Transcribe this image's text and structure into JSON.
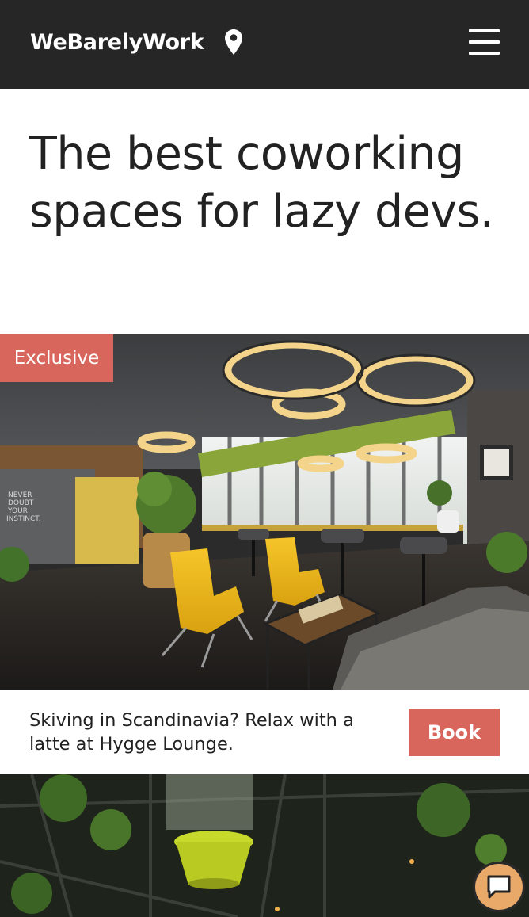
{
  "header": {
    "brand": "WeBarelyWork",
    "location_icon": "map-pin-icon",
    "menu_icon": "hamburger-menu-icon"
  },
  "hero": {
    "title": "The best coworking spaces for lazy devs."
  },
  "listings": [
    {
      "badge": "Exclusive",
      "caption": "Skiving in Scandinavia? Relax with a latte at Hygge Lounge.",
      "book_label": "Book"
    }
  ],
  "chat": {
    "icon": "chat-bubble-icon"
  },
  "colors": {
    "header_bg": "#262626",
    "accent": "#d8665c",
    "chat_bg": "#e9a969",
    "text": "#222222"
  }
}
